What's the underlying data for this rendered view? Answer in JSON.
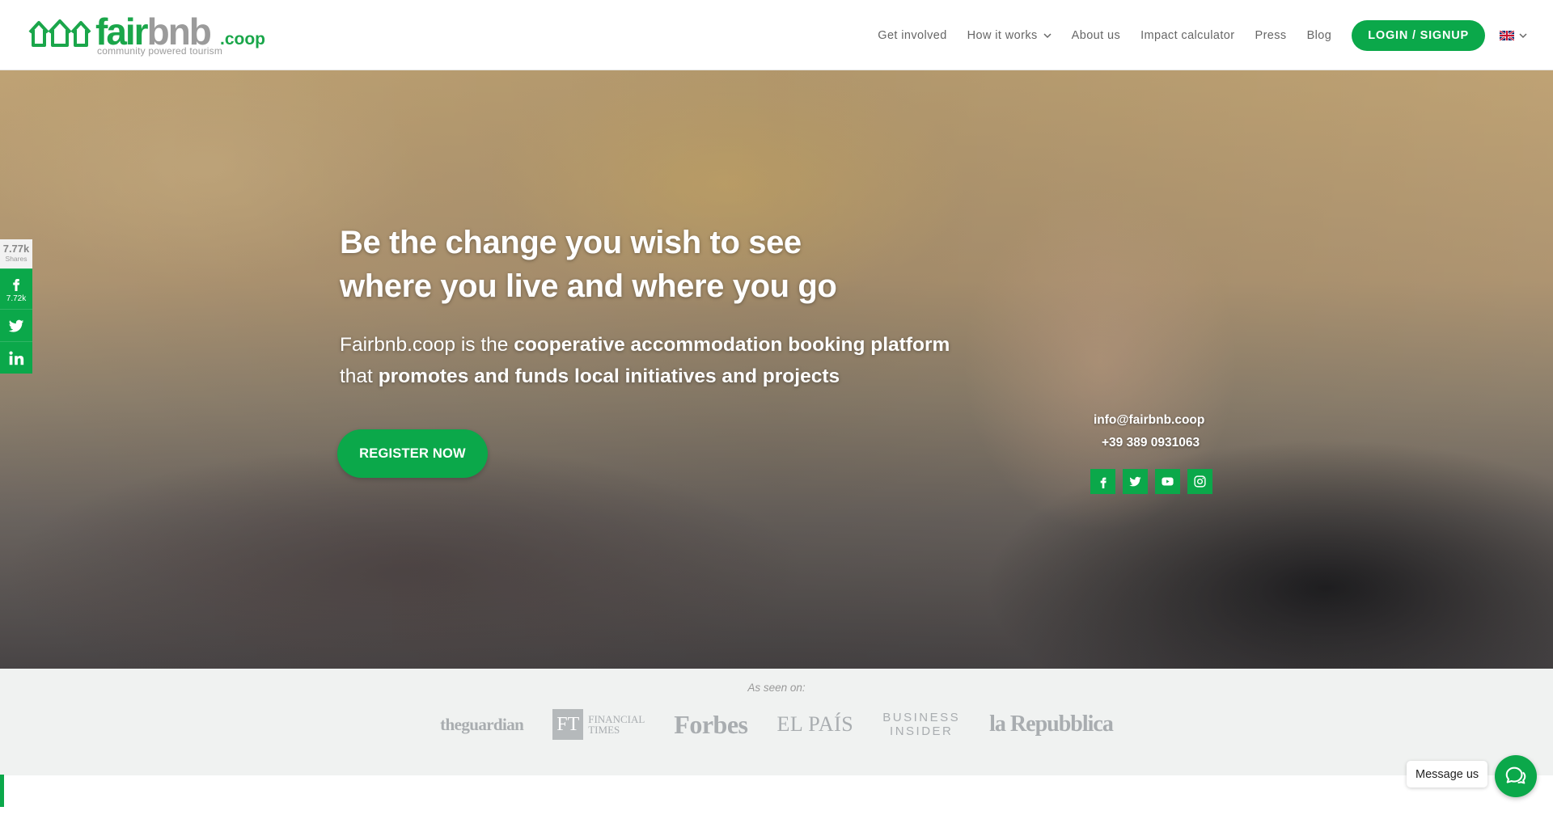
{
  "brand": {
    "name_green": "fair",
    "name_grey": "bnb",
    "suffix": ".coop",
    "tagline": "community powered tourism",
    "accent_color": "#0ba84a"
  },
  "nav": {
    "items": [
      {
        "label": "Get involved",
        "dropdown": false
      },
      {
        "label": "How it works",
        "dropdown": true
      },
      {
        "label": "About us",
        "dropdown": false
      },
      {
        "label": "Impact calculator",
        "dropdown": false
      },
      {
        "label": "Press",
        "dropdown": false
      },
      {
        "label": "Blog",
        "dropdown": false
      }
    ],
    "login_label": "LOGIN / SIGNUP",
    "language_icon": "uk-flag-icon"
  },
  "share": {
    "total": "7.77k",
    "total_label": "Shares",
    "facebook_count": "7.72k",
    "buttons": [
      "facebook-icon",
      "twitter-icon",
      "linkedin-icon"
    ]
  },
  "hero": {
    "title_line1": "Be the change you wish to see",
    "title_line2": "where you live and where you go",
    "sub": {
      "p1": "Fairbnb.coop",
      "p2": " is the ",
      "p3": "cooperative accommodation booking",
      "p4": "platform",
      "p5": " that ",
      "p6": "promotes and funds local initiatives and projects"
    },
    "cta_label": "REGISTER NOW",
    "email": "info@fairbnb.coop",
    "phone": "+39 389 0931063",
    "social": [
      "facebook-icon",
      "twitter-icon",
      "youtube-icon",
      "instagram-icon"
    ]
  },
  "press": {
    "label": "As seen on:",
    "logos": {
      "guardian": "theguardian",
      "ft_mark": "FT",
      "ft_line1": "FINANCIAL",
      "ft_line2": "TIMES",
      "forbes": "Forbes",
      "elpais": "EL PAÍS",
      "bi_line1": "BUSINESS",
      "bi_line2": "INSIDER",
      "repubblica": "la Repubblica"
    }
  },
  "chat": {
    "label": "Message us"
  }
}
